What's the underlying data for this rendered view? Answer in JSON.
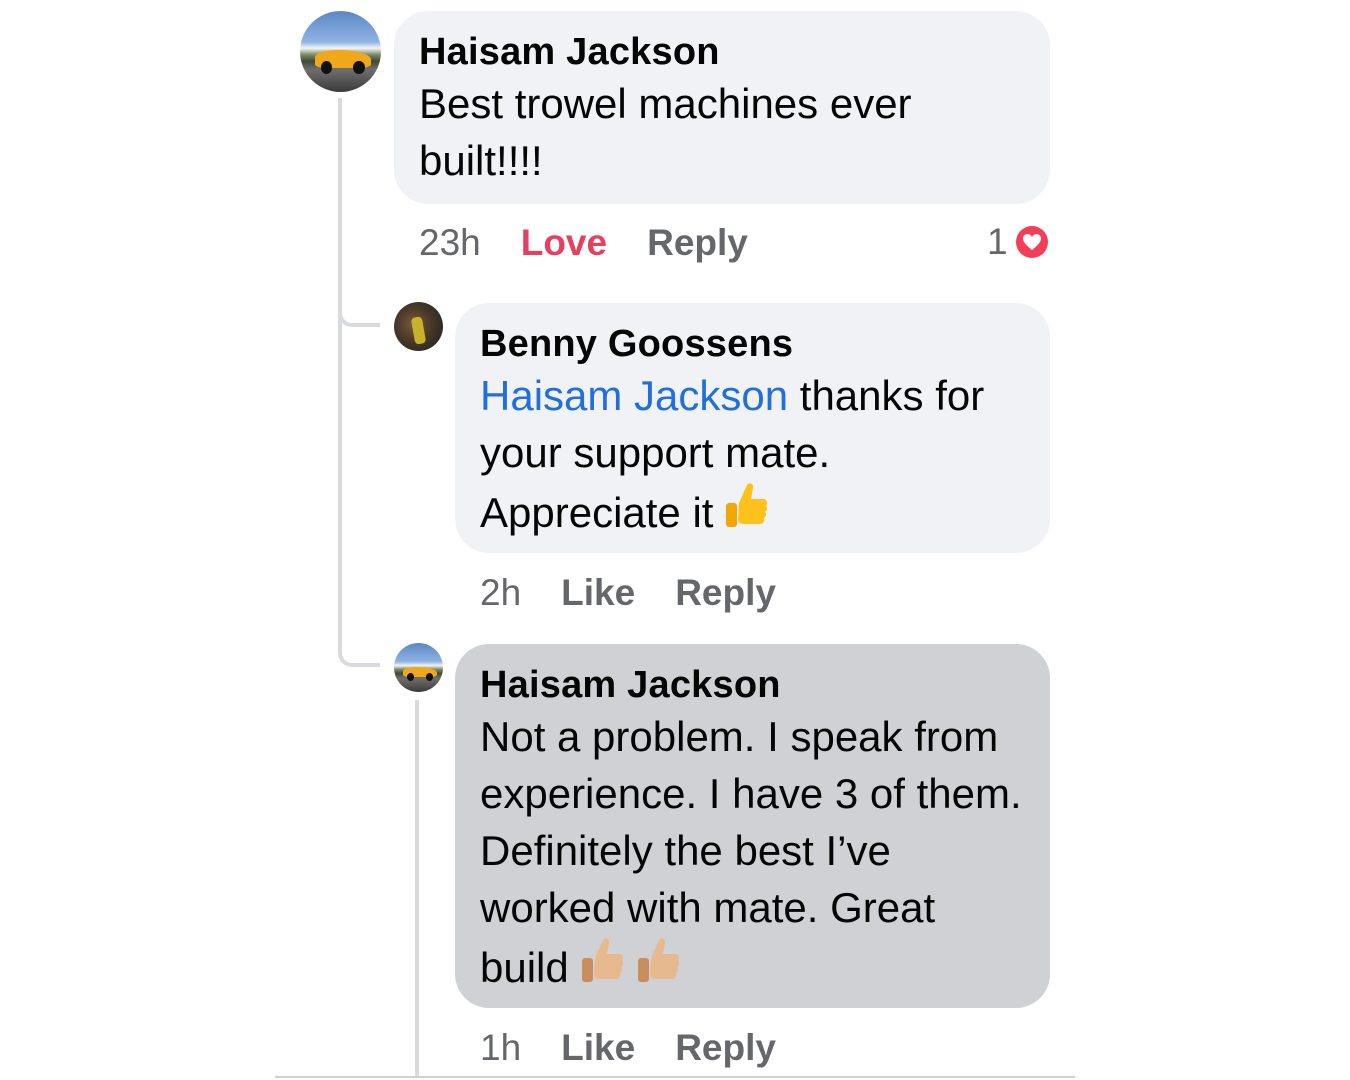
{
  "comments": [
    {
      "author": "Haisam Jackson",
      "text": "Best trowel machines ever built!!!!",
      "time": "23h",
      "reaction_action": "Love",
      "reply_label": "Reply",
      "reaction_count": "1",
      "reaction_icon": "heart-icon"
    },
    {
      "author": "Benny Goossens",
      "mention": "Haisam Jackson",
      "text_after_mention": " thanks for your support mate. Appreciate it",
      "time": "2h",
      "like_label": "Like",
      "reply_label": "Reply",
      "emoji": "thumbs-up-icon"
    },
    {
      "author": "Haisam Jackson",
      "text": "Not a problem. I speak from experience. I have 3 of them. Definitely the best I’ve worked with mate. Great build",
      "time": "1h",
      "like_label": "Like",
      "reply_label": "Reply",
      "emoji": "thumbs-up-icon"
    }
  ],
  "colors": {
    "love": "#e4405f",
    "mention": "#216fdb",
    "meta": "#65676b",
    "bubble_light": "#f0f2f5",
    "bubble_selected": "#cfd1d4"
  }
}
